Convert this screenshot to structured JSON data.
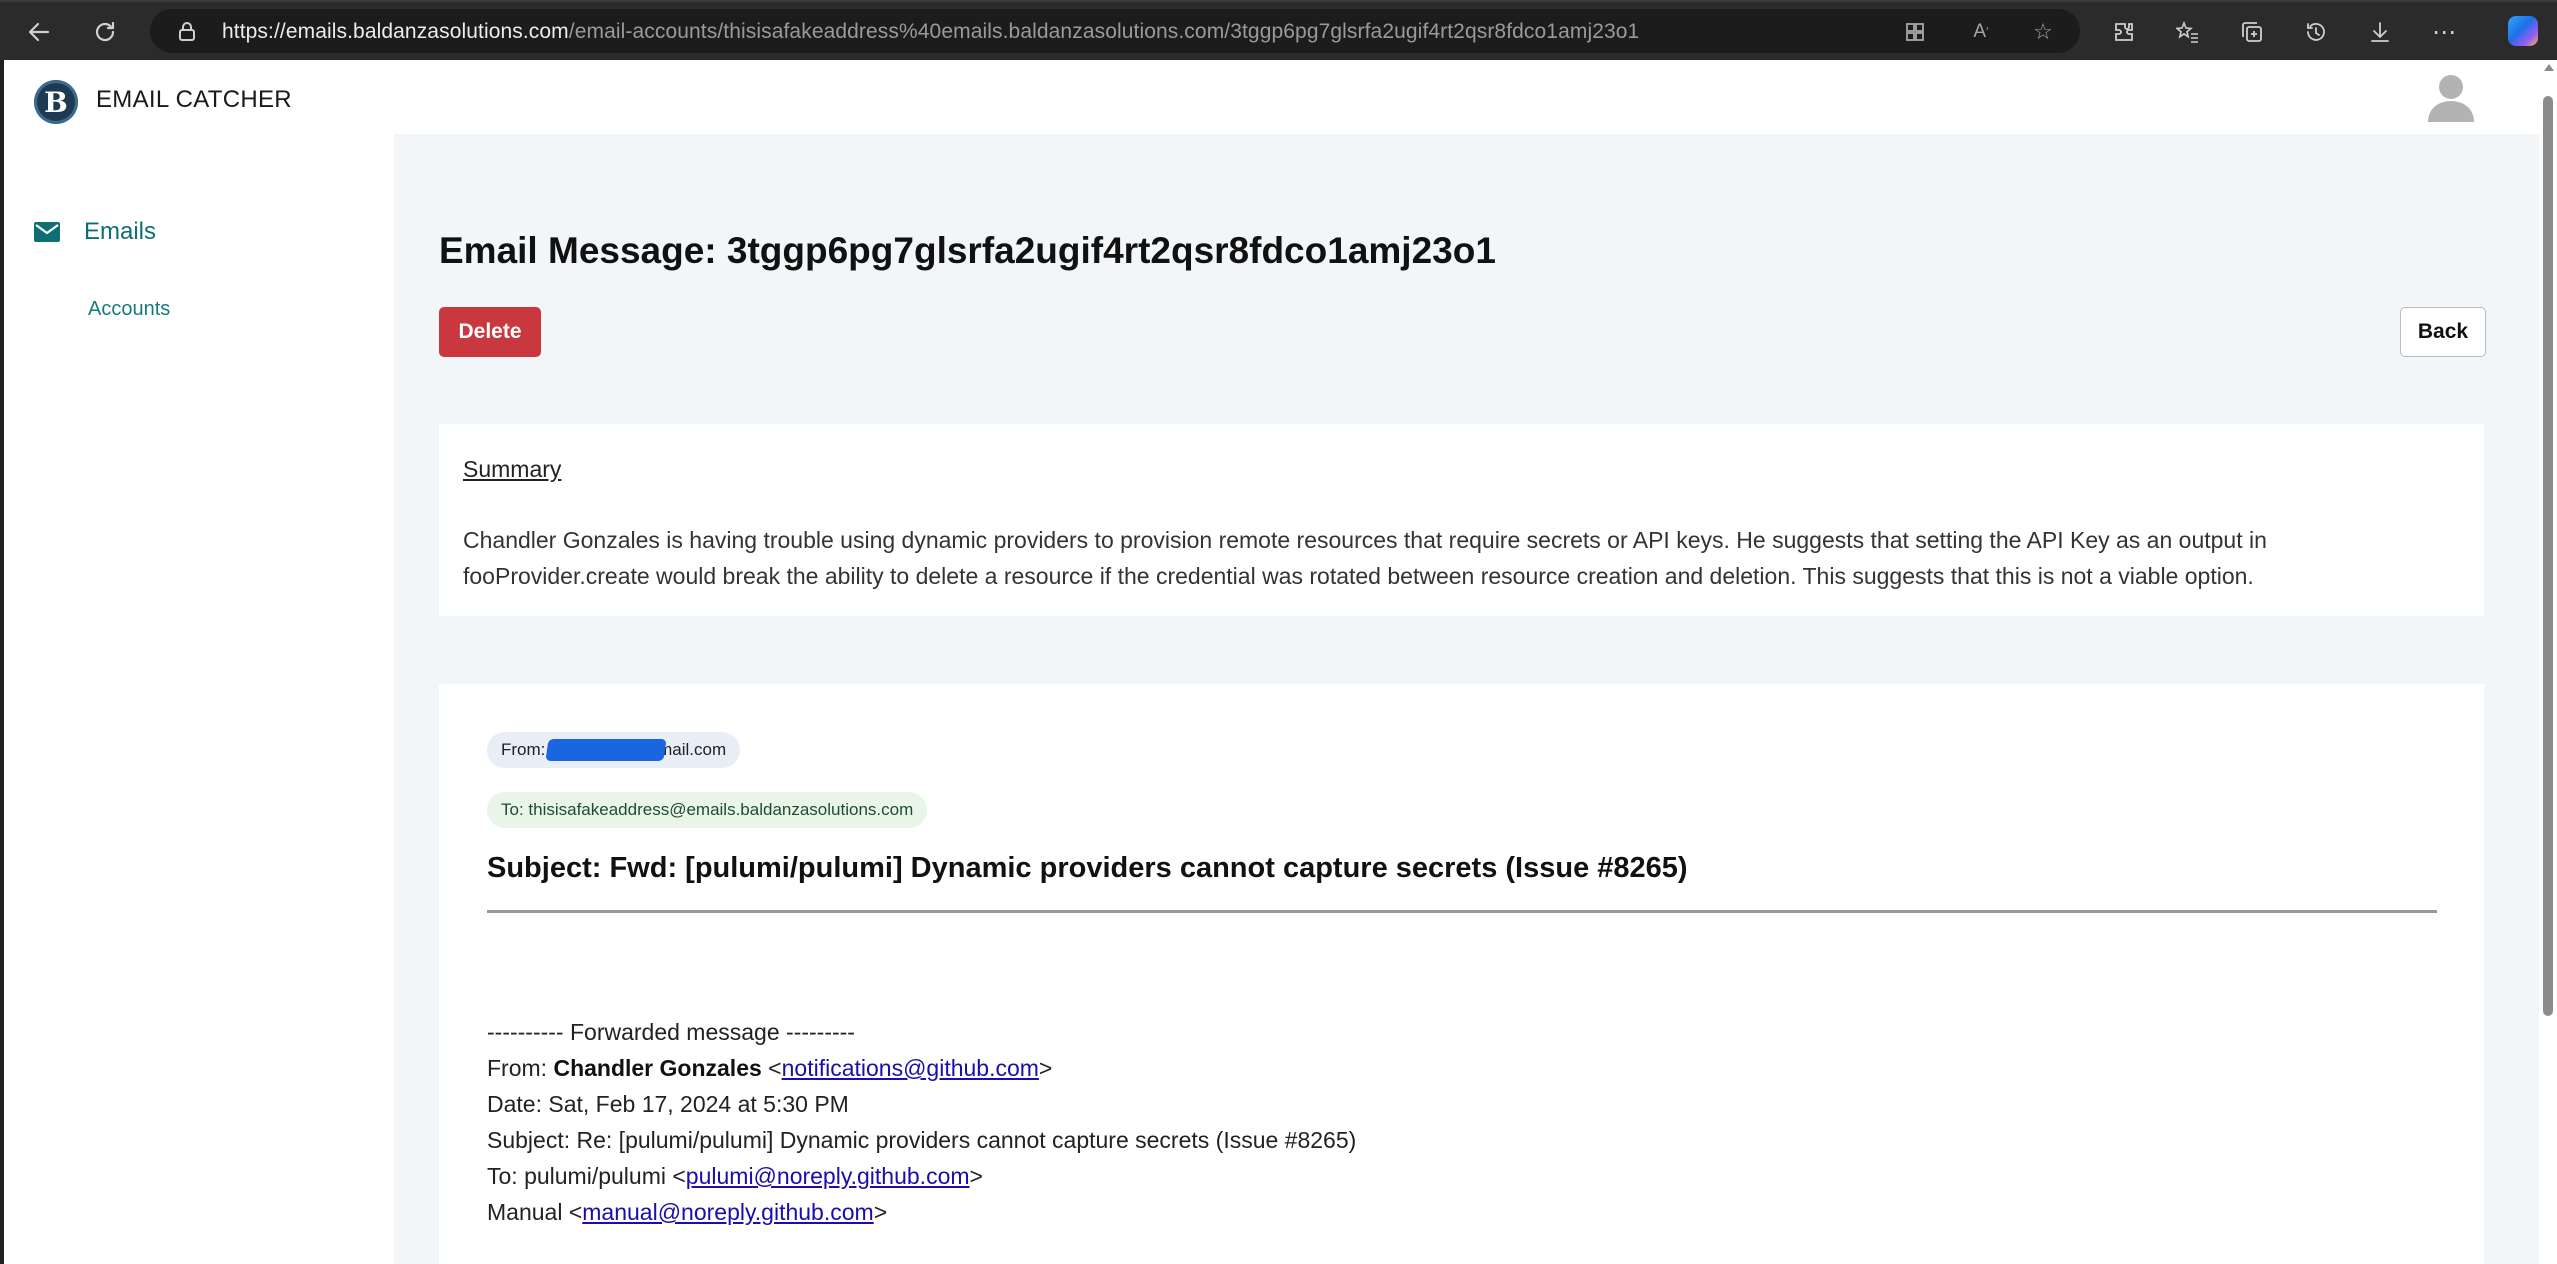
{
  "browser": {
    "url_host": "https://emails.baldanzasolutions.com",
    "url_path": "/email-accounts/thisisafakeaddress%40emails.baldanzasolutions.com/3tggp6pg7glsrfa2ugif4rt2qsr8fdco1amj23o1"
  },
  "app": {
    "title": "EMAIL CATCHER",
    "logo_letter": "B"
  },
  "sidebar": {
    "emails_label": "Emails",
    "accounts_label": "Accounts"
  },
  "page": {
    "title": "Email Message: 3tggp6pg7glsrfa2ugif4rt2qsr8fdco1amj23o1",
    "delete_label": "Delete",
    "back_label": "Back"
  },
  "summary": {
    "heading": "Summary",
    "text": "Chandler Gonzales is having trouble using dynamic providers to provision remote resources that require secrets or API keys. He suggests that setting the API Key as an output in fooProvider.create would break the ability to delete a resource if the credential was rotated between resource creation and deletion. This suggests that this is not a viable option."
  },
  "email": {
    "from_prefix": "From:",
    "from_suffix": "@gmail.com",
    "to": "To: thisisafakeaddress@emails.baldanzasolutions.com",
    "subject": "Subject: Fwd: [pulumi/pulumi] Dynamic providers cannot capture secrets (Issue #8265)",
    "forwarded_header": "---------- Forwarded message ---------",
    "fwd_from_label": "From: ",
    "fwd_from_name": "Chandler Gonzales",
    "fwd_from_email": "notifications@github.com",
    "fwd_date": "Date: Sat, Feb 17, 2024 at 5:30 PM",
    "fwd_subject": "Subject: Re: [pulumi/pulumi] Dynamic providers cannot capture secrets (Issue #8265)",
    "fwd_to_label": "To: pulumi/pulumi ",
    "fwd_to_email": "pulumi@noreply.github.com",
    "fwd_cc_label": "Manual ",
    "fwd_cc_email": "manual@noreply.github.com"
  },
  "icons": {
    "back": "arrow-left-icon",
    "refresh": "refresh-icon",
    "lock": "lock-icon",
    "mail": "envelope-icon",
    "user": "user-avatar-icon"
  }
}
